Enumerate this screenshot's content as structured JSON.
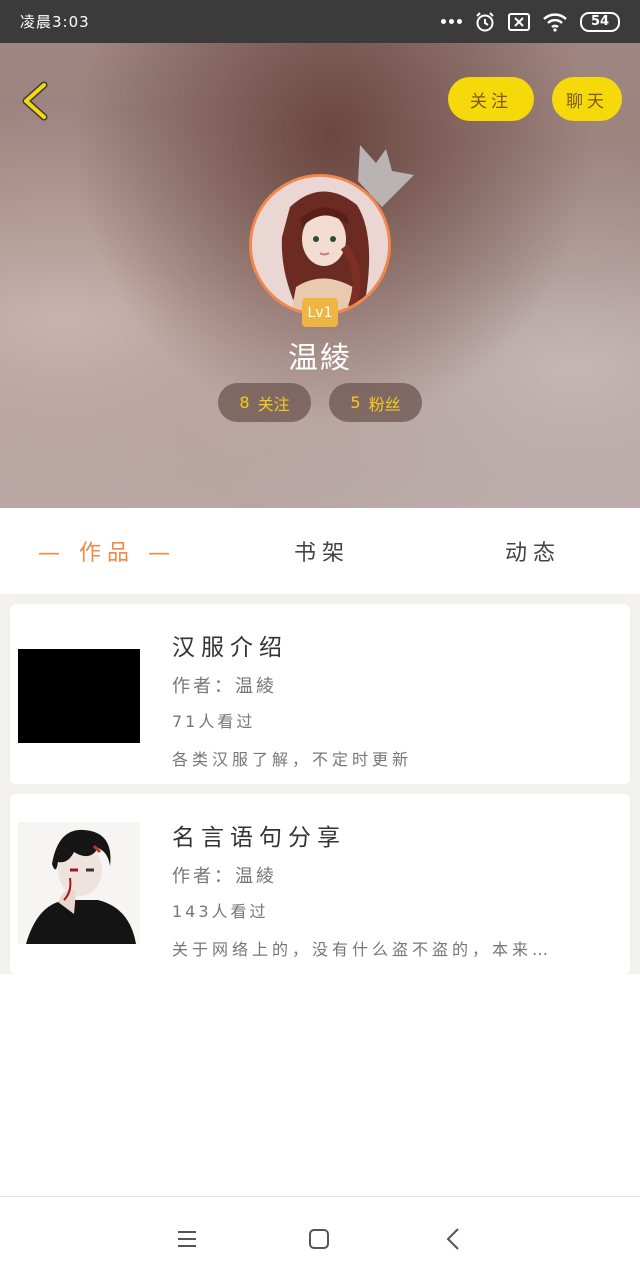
{
  "status_bar": {
    "time": "凌晨3:03",
    "battery": "54",
    "icons": [
      "more-dots-icon",
      "alarm-icon",
      "no-sim-icon",
      "wifi-icon",
      "battery-icon"
    ]
  },
  "header": {
    "back_icon": "chevron-left-icon",
    "follow_label": "关注",
    "chat_label": "聊天"
  },
  "profile": {
    "level": "Lv1",
    "username": "温綾",
    "following_count": "8",
    "following_label": "关注",
    "fans_count": "5",
    "fans_label": "粉丝"
  },
  "tabs": [
    {
      "label": "— 作品 —",
      "active": true
    },
    {
      "label": "书架",
      "active": false
    },
    {
      "label": "动态",
      "active": false
    }
  ],
  "works": [
    {
      "title": "汉服介绍",
      "author": "作者：温綾",
      "views": "71人看过",
      "description": "各类汉服了解，不定时更新"
    },
    {
      "title": "名言语句分享",
      "author": "作者：温綾",
      "views": "143人看过",
      "description": "关于网络上的，没有什么盗不盗的，本来…"
    }
  ],
  "nav_bar": {
    "icons": [
      "menu-icon",
      "home-square-icon",
      "back-arrow-icon"
    ]
  },
  "colors": {
    "accent_orange": "#ef8a46",
    "button_yellow": "#f5d90a",
    "stat_yellow": "#f3cc1a",
    "badge_orange": "#f0b443"
  }
}
